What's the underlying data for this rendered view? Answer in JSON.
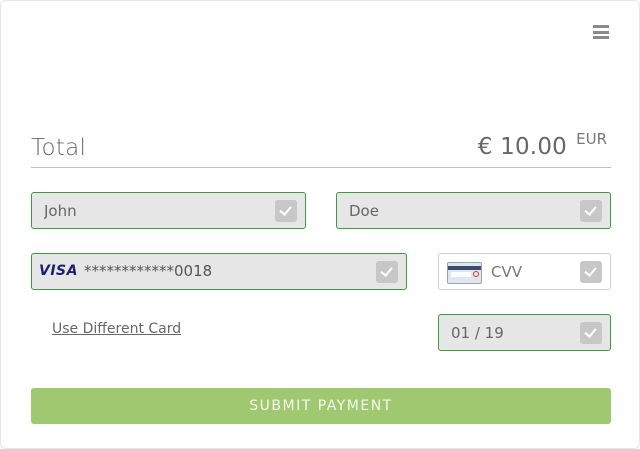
{
  "total": {
    "label": "Total",
    "amount": "€ 10.00",
    "currency": "EUR"
  },
  "form": {
    "first_name": "John",
    "last_name": "Doe",
    "card_brand": "VISA",
    "card_number": "************0018",
    "cvv_placeholder": "CVV",
    "expiry": "01 / 19",
    "use_different_card": "Use Different Card",
    "submit_label": "SUBMIT PAYMENT"
  },
  "colors": {
    "valid_border": "#3b9a3b",
    "submit_bg": "#9fc870",
    "visa_blue": "#1a1f71"
  },
  "icons": {
    "menu": "hamburger-menu-icon",
    "check": "checkmark-icon",
    "cvv": "card-back-cvv-icon"
  }
}
